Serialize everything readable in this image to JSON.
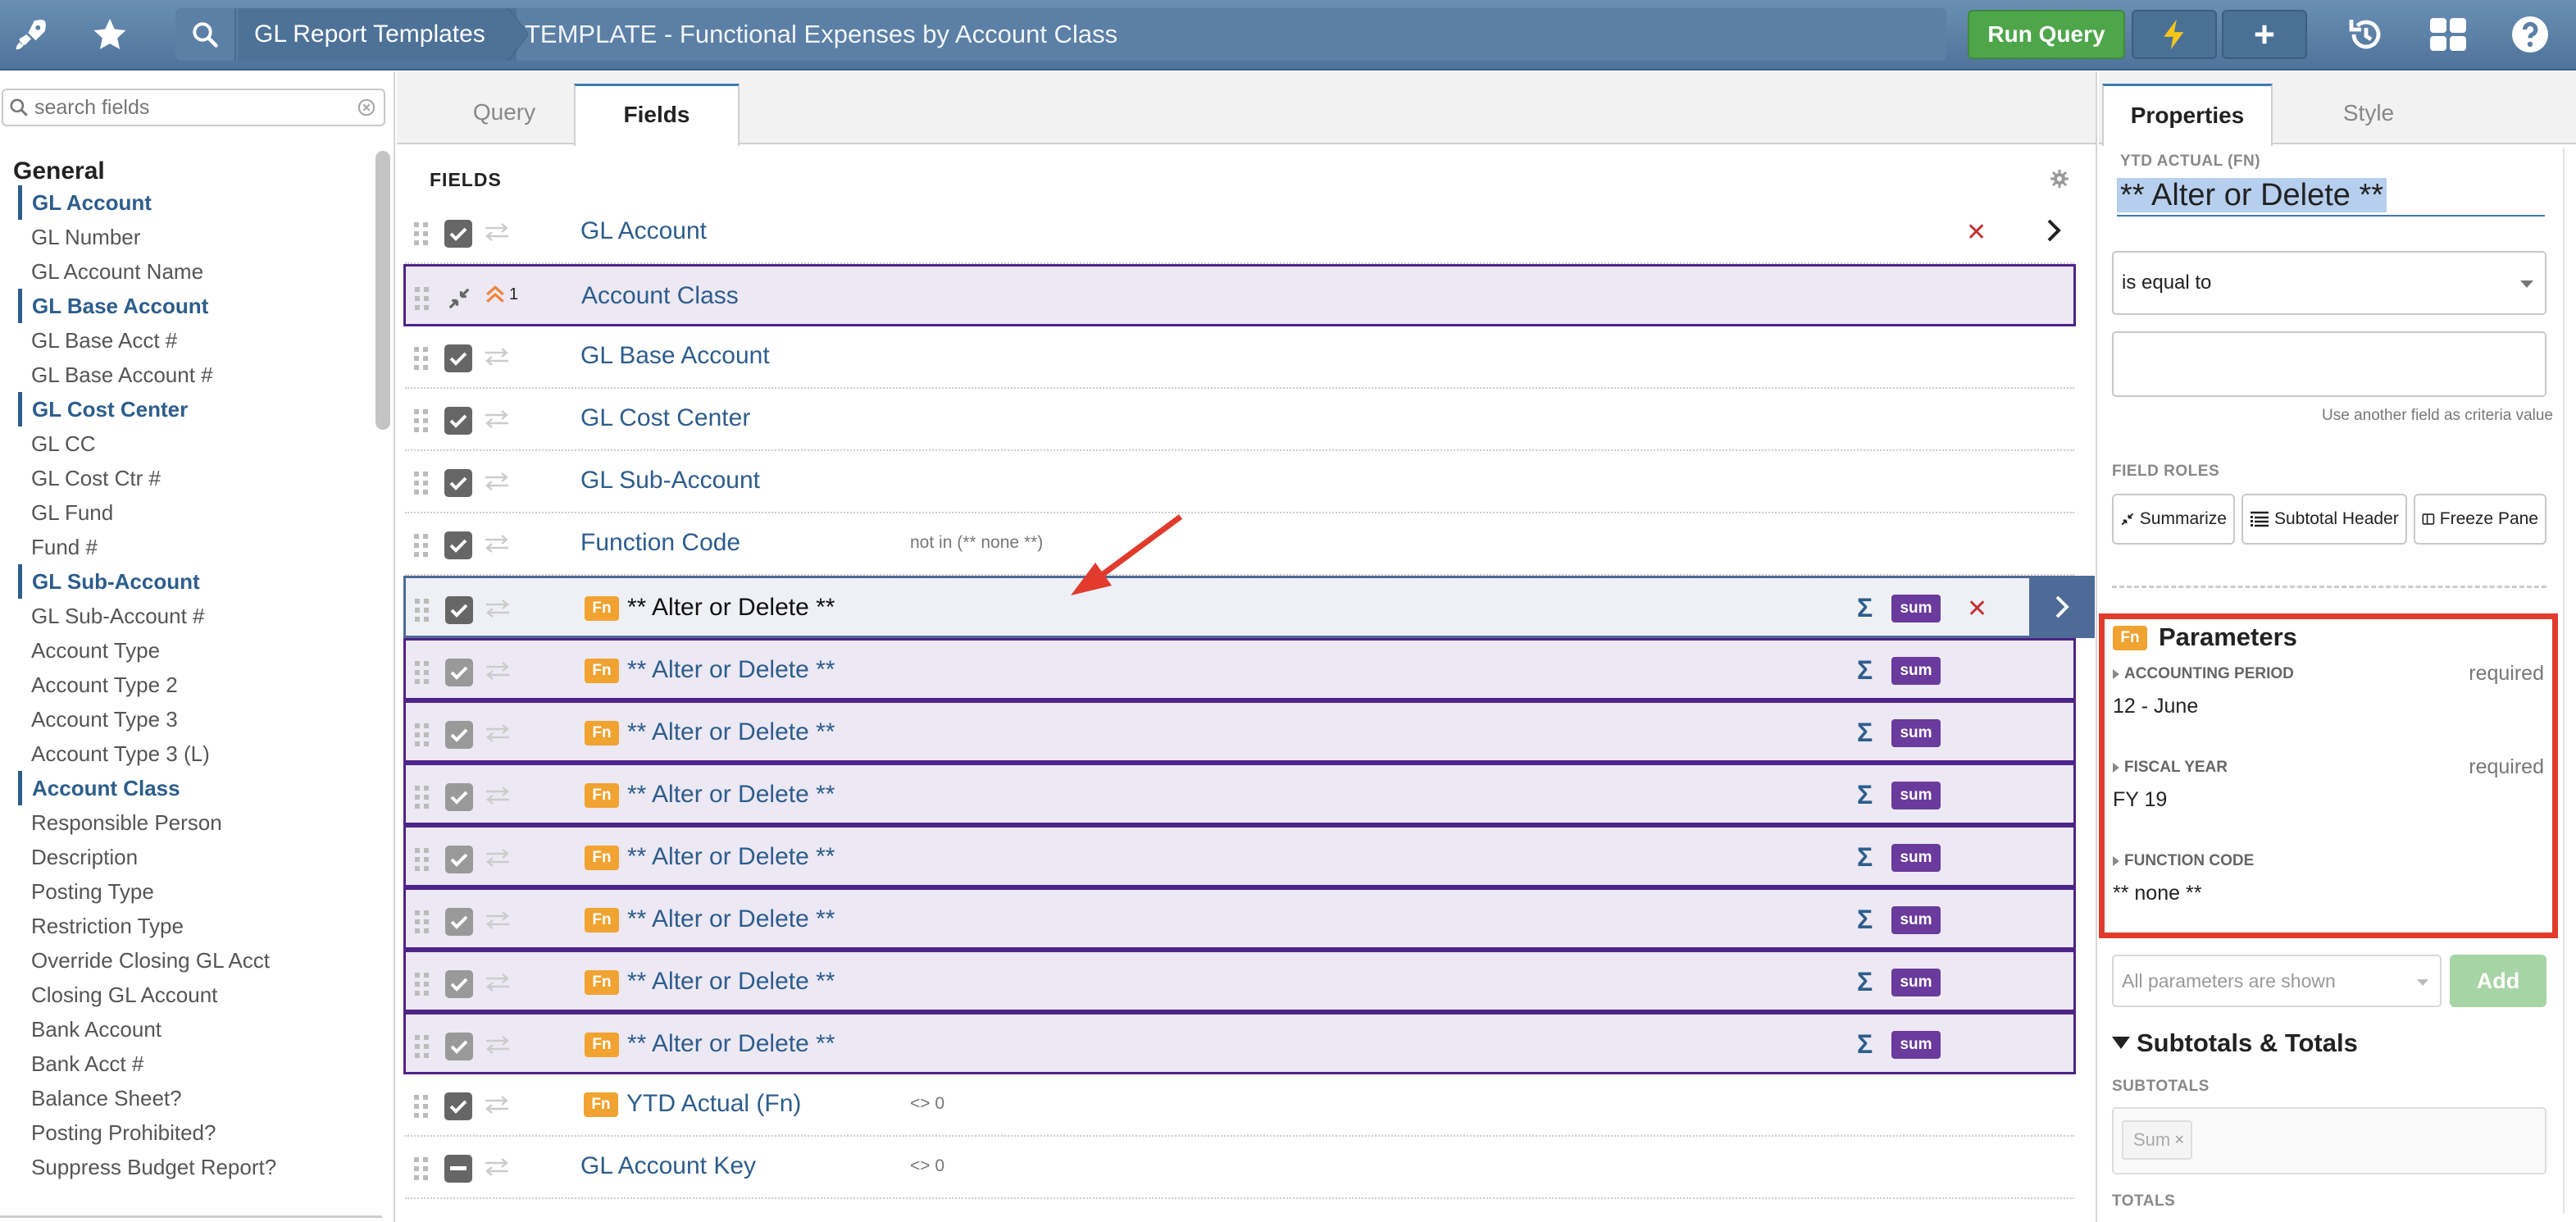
{
  "topbar": {
    "breadcrumb": [
      "GL Report Templates",
      "TEMPLATE - Functional Expenses by Account Class"
    ],
    "run_query": "Run Query",
    "icons": [
      "rocket-icon",
      "star-icon",
      "search-icon",
      "lightning-icon",
      "plus-icon",
      "history-icon",
      "grid-icon",
      "help-icon"
    ],
    "colors": {
      "bar": "#5b7fa5",
      "run": "#4ea54a",
      "accent": "#f5c518"
    }
  },
  "left": {
    "search_placeholder": "search fields",
    "group": "General",
    "fields": [
      {
        "label": "GL Account",
        "bold": true
      },
      {
        "label": "GL Number",
        "bold": false
      },
      {
        "label": "GL Account Name",
        "bold": false
      },
      {
        "label": "GL Base Account",
        "bold": true
      },
      {
        "label": "GL Base Acct #",
        "bold": false
      },
      {
        "label": "GL Base Account #",
        "bold": false
      },
      {
        "label": "GL Cost Center",
        "bold": true
      },
      {
        "label": "GL CC",
        "bold": false
      },
      {
        "label": "GL Cost Ctr #",
        "bold": false
      },
      {
        "label": "GL Fund",
        "bold": false
      },
      {
        "label": "Fund #",
        "bold": false
      },
      {
        "label": "GL Sub-Account",
        "bold": true
      },
      {
        "label": "GL Sub-Account #",
        "bold": false
      },
      {
        "label": "Account Type",
        "bold": false
      },
      {
        "label": "Account Type 2",
        "bold": false
      },
      {
        "label": "Account Type 3",
        "bold": false
      },
      {
        "label": "Account Type 3 (L)",
        "bold": false
      },
      {
        "label": "Account Class",
        "bold": true
      },
      {
        "label": "Responsible Person",
        "bold": false
      },
      {
        "label": "Description",
        "bold": false
      },
      {
        "label": "Posting Type",
        "bold": false
      },
      {
        "label": "Restriction Type",
        "bold": false
      },
      {
        "label": "Override Closing GL Acct",
        "bold": false
      },
      {
        "label": "Closing GL Account",
        "bold": false
      },
      {
        "label": "Bank Account",
        "bold": false
      },
      {
        "label": "Bank Acct #",
        "bold": false
      },
      {
        "label": "Balance Sheet?",
        "bold": false
      },
      {
        "label": "Posting Prohibited?",
        "bold": false
      },
      {
        "label": "Suppress Budget Report?",
        "bold": false
      }
    ]
  },
  "center": {
    "tabs": [
      "Query",
      "Fields"
    ],
    "active_tab": "Fields",
    "header": "FIELDS",
    "rows": [
      {
        "label": "GL Account",
        "kind": "normal",
        "fn": false,
        "criteria": "",
        "remove": true,
        "chevron": "plain"
      },
      {
        "label": "Account Class",
        "kind": "group",
        "fn": false,
        "criteria": "",
        "group_level": "1"
      },
      {
        "label": "GL Base Account",
        "kind": "normal",
        "fn": false,
        "criteria": ""
      },
      {
        "label": "GL Cost Center",
        "kind": "normal",
        "fn": false,
        "criteria": ""
      },
      {
        "label": "GL Sub-Account",
        "kind": "normal",
        "fn": false,
        "criteria": ""
      },
      {
        "label": "Function Code",
        "kind": "normal",
        "fn": false,
        "criteria": "not in (** none **)"
      },
      {
        "label": "** Alter or Delete **",
        "kind": "selected",
        "fn": true,
        "criteria": "",
        "sigma": "Σ",
        "sum": "sum",
        "remove": true,
        "chevron": "dark"
      },
      {
        "label": "** Alter or Delete **",
        "kind": "purple",
        "fn": true,
        "criteria": "",
        "sigma": "Σ",
        "sum": "sum"
      },
      {
        "label": "** Alter or Delete **",
        "kind": "purple",
        "fn": true,
        "criteria": "",
        "sigma": "Σ",
        "sum": "sum"
      },
      {
        "label": "** Alter or Delete **",
        "kind": "purple",
        "fn": true,
        "criteria": "",
        "sigma": "Σ",
        "sum": "sum"
      },
      {
        "label": "** Alter or Delete **",
        "kind": "purple",
        "fn": true,
        "criteria": "",
        "sigma": "Σ",
        "sum": "sum"
      },
      {
        "label": "** Alter or Delete **",
        "kind": "purple",
        "fn": true,
        "criteria": "",
        "sigma": "Σ",
        "sum": "sum"
      },
      {
        "label": "** Alter or Delete **",
        "kind": "purple",
        "fn": true,
        "criteria": "",
        "sigma": "Σ",
        "sum": "sum"
      },
      {
        "label": "** Alter or Delete **",
        "kind": "purple",
        "fn": true,
        "criteria": "",
        "sigma": "Σ",
        "sum": "sum"
      },
      {
        "label": "YTD Actual (Fn)",
        "kind": "normal",
        "fn": true,
        "criteria": "<> 0"
      },
      {
        "label": "GL Account Key",
        "kind": "normal",
        "fn": false,
        "criteria": "<> 0",
        "checkbox": "minus"
      }
    ],
    "fn_badge": "Fn"
  },
  "right": {
    "tabs": [
      "Properties",
      "Style"
    ],
    "active_tab": "Properties",
    "field_label": "YTD ACTUAL (FN)",
    "field_name": "** Alter or Delete **",
    "operator": "is equal to",
    "criteria_value": "",
    "hint": "Use another field as criteria value",
    "roles_label": "FIELD ROLES",
    "roles": [
      "Summarize",
      "Subtotal Header",
      "Freeze Pane"
    ],
    "parameters": {
      "title": "Parameters",
      "items": [
        {
          "label": "ACCOUNTING PERIOD",
          "required": "required",
          "value": "12 - June"
        },
        {
          "label": "FISCAL YEAR",
          "required": "required",
          "value": "FY 19"
        },
        {
          "label": "FUNCTION CODE",
          "required": "",
          "value": "** none **"
        }
      ]
    },
    "all_params": "All parameters are shown",
    "add": "Add",
    "subtotals_title": "Subtotals & Totals",
    "subtotals_label": "SUBTOTALS",
    "subtotal_tag": "Sum",
    "subtotal_tag_remove": "×",
    "totals_label": "TOTALS"
  }
}
